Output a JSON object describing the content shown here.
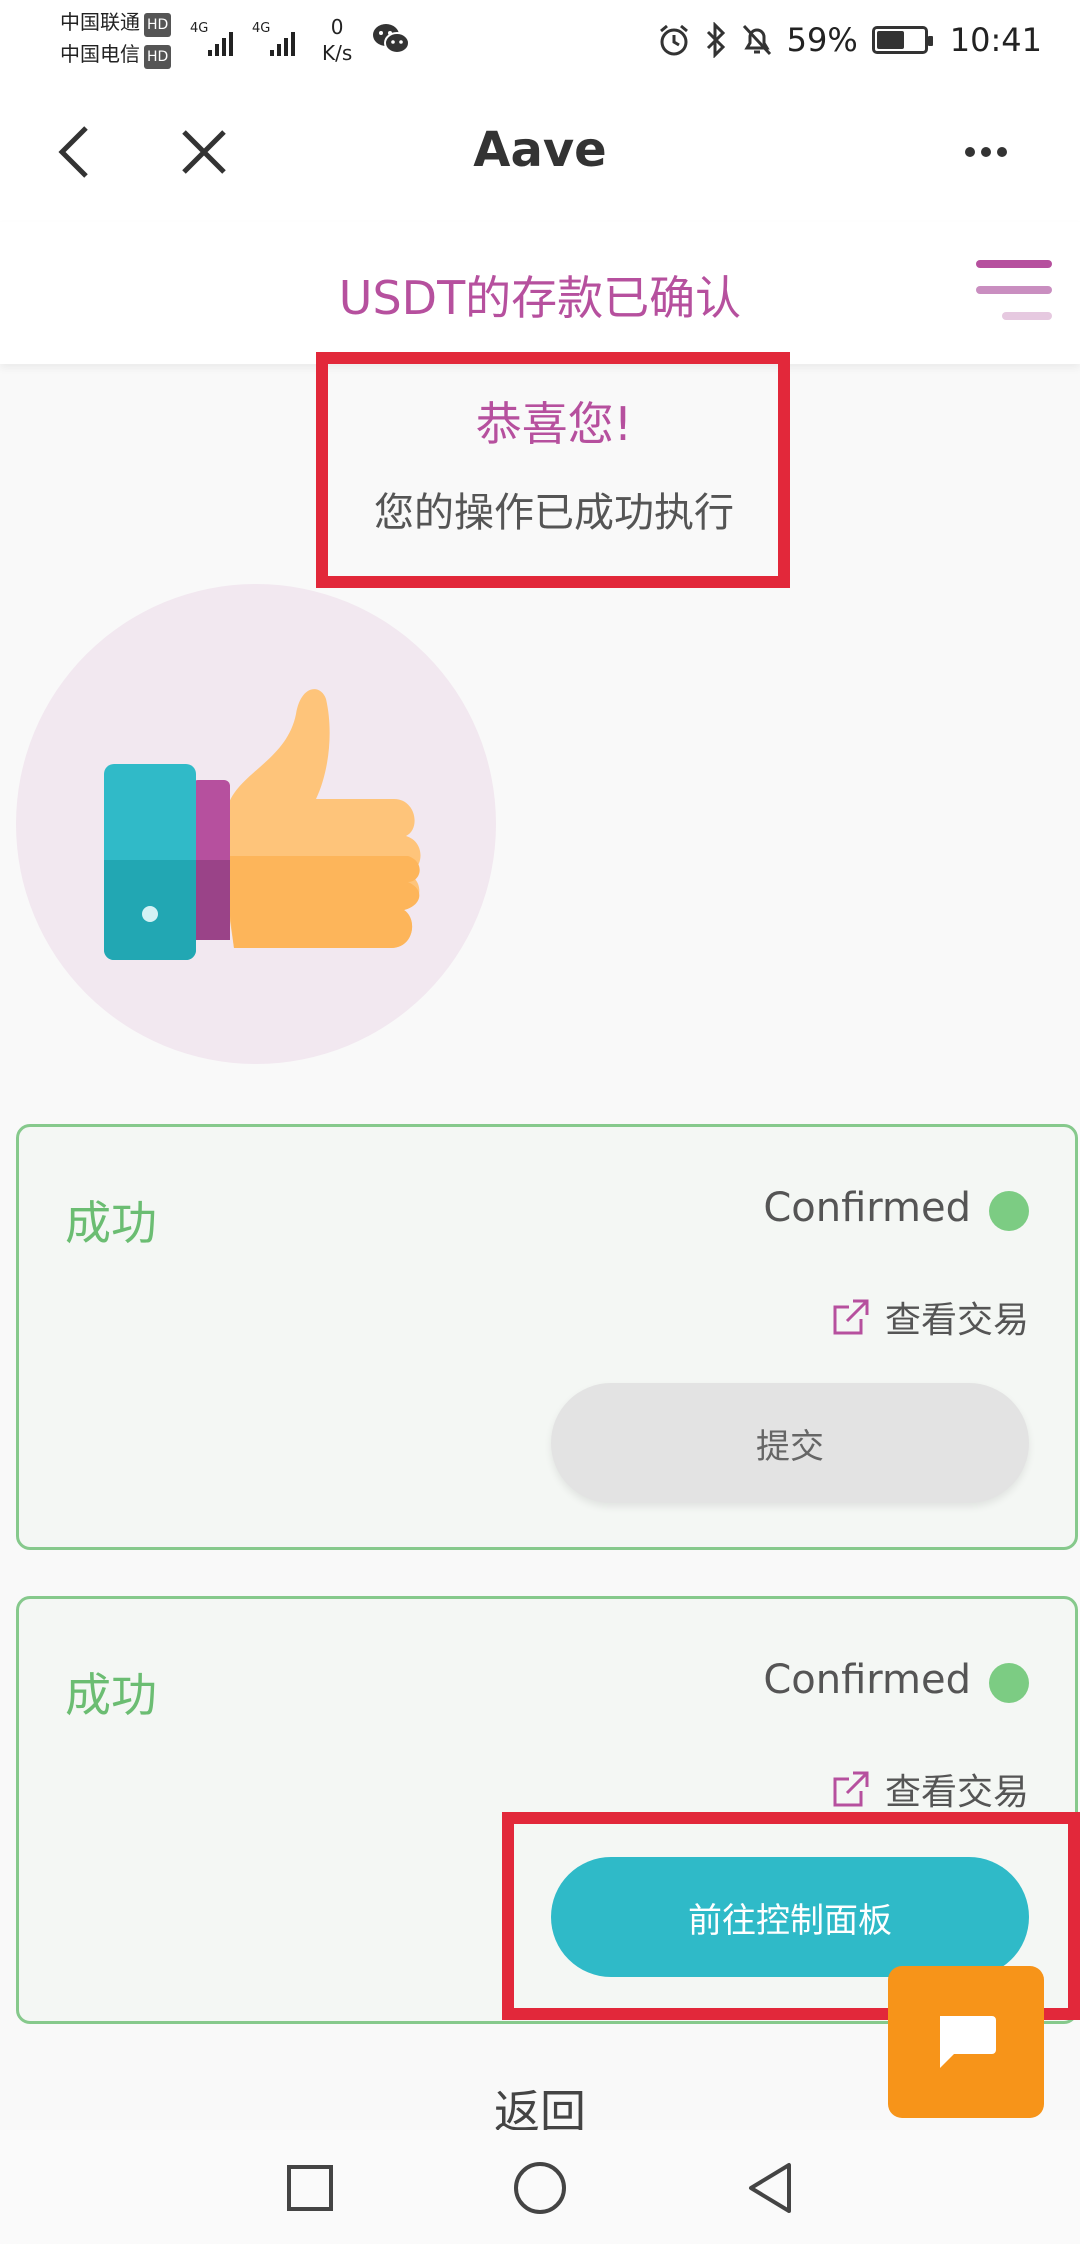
{
  "status_bar": {
    "carrier1": "中国联通",
    "carrier2": "中国电信",
    "hd": "HD",
    "network1": "4G",
    "network2": "4G",
    "net_speed_value": "0",
    "net_speed_unit": "K/s",
    "battery_percent": "59%",
    "battery_level": 0.59,
    "time": "10:41"
  },
  "app_bar": {
    "title": "Aave"
  },
  "subheader": {
    "title": "USDT的存款已确认"
  },
  "congrats": {
    "title": "恭喜您!",
    "subtitle": "您的操作已成功执行"
  },
  "cards": [
    {
      "status": "成功",
      "confirmed": "Confirmed",
      "view_tx": "查看交易",
      "button": "提交"
    },
    {
      "status": "成功",
      "confirmed": "Confirmed",
      "view_tx": "查看交易",
      "button": "前往控制面板"
    }
  ],
  "back": "返回",
  "colors": {
    "brand": "#b6509e",
    "success": "#6bbd72",
    "teal": "#2fbac8",
    "highlight": "#e2283a",
    "fab": "#f79419"
  }
}
